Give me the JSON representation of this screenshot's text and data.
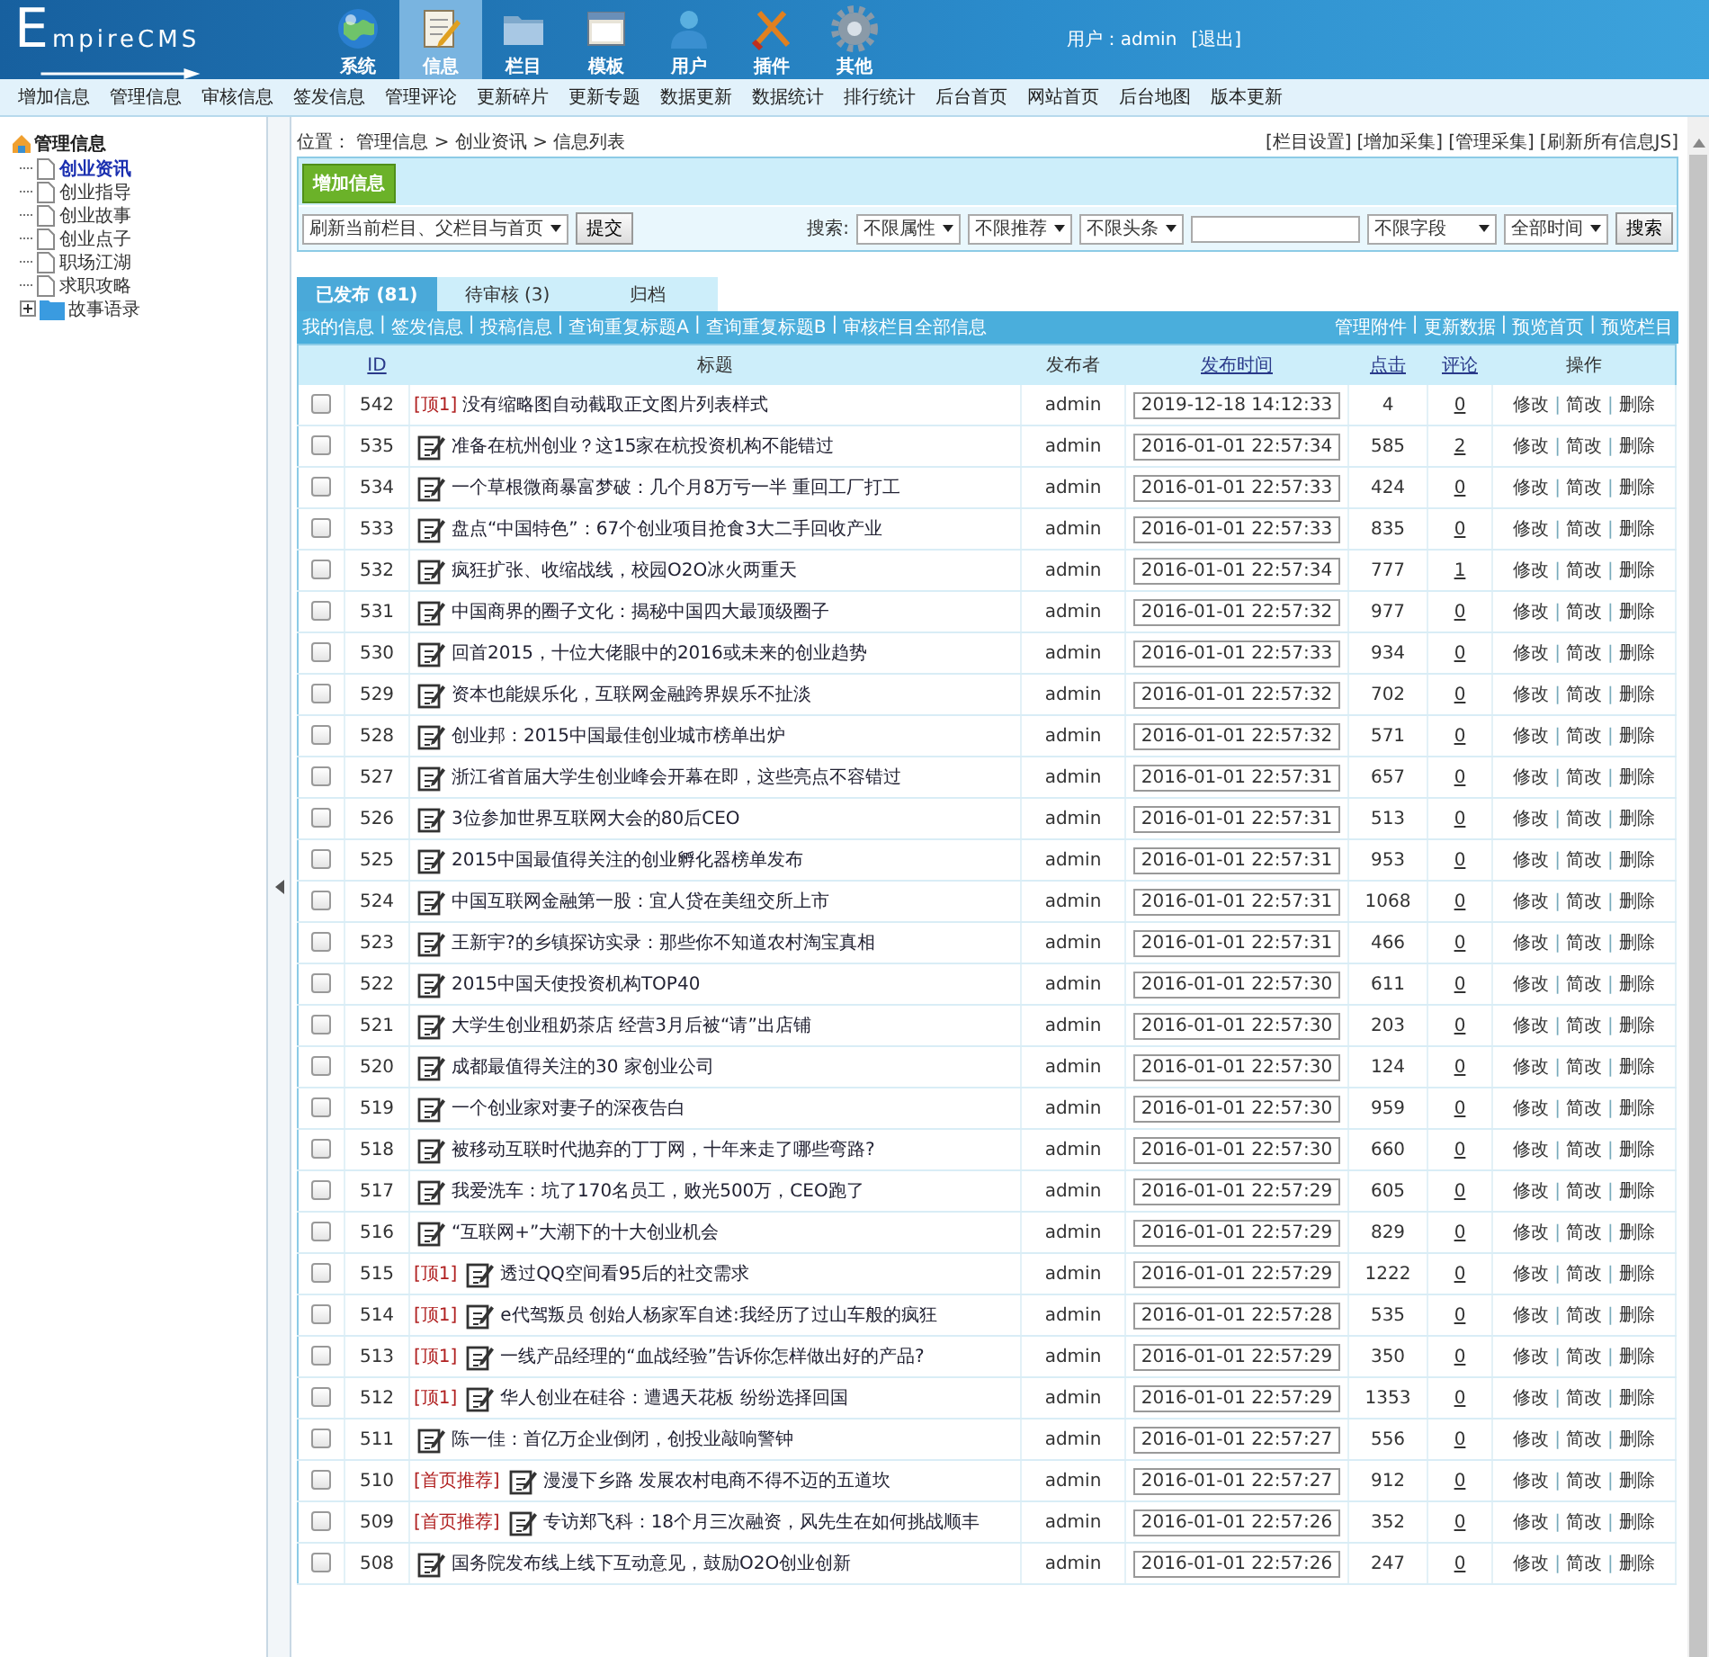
{
  "header": {
    "logo": "EmpireCMS",
    "nav": [
      {
        "label": "系统",
        "selected": false
      },
      {
        "label": "信息",
        "selected": true
      },
      {
        "label": "栏目",
        "selected": false
      },
      {
        "label": "模板",
        "selected": false
      },
      {
        "label": "用户",
        "selected": false
      },
      {
        "label": "插件",
        "selected": false
      },
      {
        "label": "其他",
        "selected": false
      }
    ],
    "user": "用户：admin",
    "logout": "[退出]"
  },
  "menu": [
    "增加信息",
    "管理信息",
    "审核信息",
    "签发信息",
    "管理评论",
    "更新碎片",
    "更新专题",
    "数据更新",
    "数据统计",
    "排行统计",
    "后台首页",
    "网站首页",
    "后台地图",
    "版本更新"
  ],
  "sidebar": {
    "root": "管理信息",
    "items": [
      {
        "label": "创业资讯",
        "selected": true,
        "kind": "page"
      },
      {
        "label": "创业指导",
        "selected": false,
        "kind": "page"
      },
      {
        "label": "创业故事",
        "selected": false,
        "kind": "page"
      },
      {
        "label": "创业点子",
        "selected": false,
        "kind": "page"
      },
      {
        "label": "职场江湖",
        "selected": false,
        "kind": "page"
      },
      {
        "label": "求职攻略",
        "selected": false,
        "kind": "page"
      },
      {
        "label": "故事语录",
        "selected": false,
        "kind": "folder",
        "expanded": false
      }
    ]
  },
  "breadcrumb": {
    "label": "位置：",
    "path": "管理信息 > 创业资讯 > 信息列表"
  },
  "top_links": [
    "[栏目设置]",
    "[增加采集]",
    "[管理采集]",
    "[刷新所有信息JS]"
  ],
  "toolbar": {
    "add_button": "增加信息",
    "refresh_select": "刷新当前栏目、父栏目与首页",
    "submit_button": "提交",
    "search_label": "搜索:",
    "filters": [
      "不限属性",
      "不限推荐",
      "不限头条"
    ],
    "field_select": "不限字段",
    "time_select": "全部时间",
    "search_button": "搜索"
  },
  "tabs": [
    {
      "label": "已发布 (81)",
      "selected": true
    },
    {
      "label": "待审核 (3)",
      "selected": false
    },
    {
      "label": "归档",
      "selected": false
    }
  ],
  "separator": "|",
  "links_left": [
    "我的信息",
    "签发信息",
    "投稿信息",
    "查询重复标题A",
    "查询重复标题B",
    "审核栏目全部信息"
  ],
  "links_right": [
    "管理附件",
    "更新数据",
    "预览首页",
    "预览栏目"
  ],
  "table": {
    "columns": [
      {
        "label": "ID",
        "sortable": true
      },
      {
        "label": "标题",
        "sortable": false
      },
      {
        "label": "发布者",
        "sortable": false
      },
      {
        "label": "发布时间",
        "sortable": true
      },
      {
        "label": "点击",
        "sortable": true
      },
      {
        "label": "评论",
        "sortable": true
      },
      {
        "label": "操作",
        "sortable": false
      }
    ],
    "rows": [
      {
        "id": "542",
        "tag": "[顶1]",
        "icon": false,
        "title": "没有缩略图自动截取正文图片列表样式",
        "author": "admin",
        "time": "2019-12-18 14:12:33",
        "clicks": "4",
        "comments": "0",
        "checked": false,
        "actions": [
          "修改",
          "简改",
          "删除"
        ]
      },
      {
        "id": "535",
        "icon": true,
        "title": "准备在杭州创业？这15家在杭投资机构不能错过",
        "author": "admin",
        "time": "2016-01-01 22:57:34",
        "clicks": "585",
        "comments": "2",
        "checked": false,
        "actions": [
          "修改",
          "简改",
          "删除"
        ]
      },
      {
        "id": "534",
        "icon": true,
        "title": "一个草根微商暴富梦破：几个月8万亏一半 重回工厂打工",
        "author": "admin",
        "time": "2016-01-01 22:57:33",
        "clicks": "424",
        "comments": "0",
        "checked": false,
        "actions": [
          "修改",
          "简改",
          "删除"
        ]
      },
      {
        "id": "533",
        "icon": true,
        "title": "盘点“中国特色”：67个创业项目抢食3大二手回收产业",
        "author": "admin",
        "time": "2016-01-01 22:57:33",
        "clicks": "835",
        "comments": "0",
        "checked": false,
        "actions": [
          "修改",
          "简改",
          "删除"
        ]
      },
      {
        "id": "532",
        "icon": true,
        "title": "疯狂扩张、收缩战线，校园O2O冰火两重天",
        "author": "admin",
        "time": "2016-01-01 22:57:34",
        "clicks": "777",
        "comments": "1",
        "checked": false,
        "actions": [
          "修改",
          "简改",
          "删除"
        ]
      },
      {
        "id": "531",
        "icon": true,
        "title": "中国商界的圈子文化：揭秘中国四大最顶级圈子",
        "author": "admin",
        "time": "2016-01-01 22:57:32",
        "clicks": "977",
        "comments": "0",
        "checked": false,
        "actions": [
          "修改",
          "简改",
          "删除"
        ]
      },
      {
        "id": "530",
        "icon": true,
        "title": "回首2015，十位大佬眼中的2016或未来的创业趋势",
        "author": "admin",
        "time": "2016-01-01 22:57:33",
        "clicks": "934",
        "comments": "0",
        "checked": false,
        "actions": [
          "修改",
          "简改",
          "删除"
        ]
      },
      {
        "id": "529",
        "icon": true,
        "title": "资本也能娱乐化，互联网金融跨界娱乐不扯淡",
        "author": "admin",
        "time": "2016-01-01 22:57:32",
        "clicks": "702",
        "comments": "0",
        "checked": false,
        "actions": [
          "修改",
          "简改",
          "删除"
        ]
      },
      {
        "id": "528",
        "icon": true,
        "title": "创业邦：2015中国最佳创业城市榜单出炉",
        "author": "admin",
        "time": "2016-01-01 22:57:32",
        "clicks": "571",
        "comments": "0",
        "checked": false,
        "actions": [
          "修改",
          "简改",
          "删除"
        ]
      },
      {
        "id": "527",
        "icon": true,
        "title": "浙江省首届大学生创业峰会开幕在即，这些亮点不容错过",
        "author": "admin",
        "time": "2016-01-01 22:57:31",
        "clicks": "657",
        "comments": "0",
        "checked": false,
        "actions": [
          "修改",
          "简改",
          "删除"
        ]
      },
      {
        "id": "526",
        "icon": true,
        "title": "3位参加世界互联网大会的80后CEO",
        "author": "admin",
        "time": "2016-01-01 22:57:31",
        "clicks": "513",
        "comments": "0",
        "checked": false,
        "actions": [
          "修改",
          "简改",
          "删除"
        ]
      },
      {
        "id": "525",
        "icon": true,
        "title": "2015中国最值得关注的创业孵化器榜单发布",
        "author": "admin",
        "time": "2016-01-01 22:57:31",
        "clicks": "953",
        "comments": "0",
        "checked": false,
        "actions": [
          "修改",
          "简改",
          "删除"
        ]
      },
      {
        "id": "524",
        "icon": true,
        "title": "中国互联网金融第一股：宜人贷在美纽交所上市",
        "author": "admin",
        "time": "2016-01-01 22:57:31",
        "clicks": "1068",
        "comments": "0",
        "checked": false,
        "actions": [
          "修改",
          "简改",
          "删除"
        ]
      },
      {
        "id": "523",
        "icon": true,
        "title": "王新宇?的乡镇探访实录：那些你不知道农村淘宝真相",
        "author": "admin",
        "time": "2016-01-01 22:57:31",
        "clicks": "466",
        "comments": "0",
        "checked": false,
        "actions": [
          "修改",
          "简改",
          "删除"
        ]
      },
      {
        "id": "522",
        "icon": true,
        "title": "2015中国天使投资机构TOP40",
        "author": "admin",
        "time": "2016-01-01 22:57:30",
        "clicks": "611",
        "comments": "0",
        "checked": false,
        "actions": [
          "修改",
          "简改",
          "删除"
        ]
      },
      {
        "id": "521",
        "icon": true,
        "title": "大学生创业租奶茶店 经营3月后被“请”出店铺",
        "author": "admin",
        "time": "2016-01-01 22:57:30",
        "clicks": "203",
        "comments": "0",
        "checked": false,
        "actions": [
          "修改",
          "简改",
          "删除"
        ]
      },
      {
        "id": "520",
        "icon": true,
        "title": "成都最值得关注的30 家创业公司",
        "author": "admin",
        "time": "2016-01-01 22:57:30",
        "clicks": "124",
        "comments": "0",
        "checked": false,
        "actions": [
          "修改",
          "简改",
          "删除"
        ]
      },
      {
        "id": "519",
        "icon": true,
        "title": "一个创业家对妻子的深夜告白",
        "author": "admin",
        "time": "2016-01-01 22:57:30",
        "clicks": "959",
        "comments": "0",
        "checked": false,
        "actions": [
          "修改",
          "简改",
          "删除"
        ]
      },
      {
        "id": "518",
        "icon": true,
        "title": "被移动互联时代抛弃的丁丁网，十年来走了哪些弯路?",
        "author": "admin",
        "time": "2016-01-01 22:57:30",
        "clicks": "660",
        "comments": "0",
        "checked": false,
        "actions": [
          "修改",
          "简改",
          "删除"
        ]
      },
      {
        "id": "517",
        "icon": true,
        "title": "我爱洗车：坑了170名员工，败光500万，CEO跑了",
        "author": "admin",
        "time": "2016-01-01 22:57:29",
        "clicks": "605",
        "comments": "0",
        "checked": false,
        "actions": [
          "修改",
          "简改",
          "删除"
        ]
      },
      {
        "id": "516",
        "icon": true,
        "title": "“互联网+”大潮下的十大创业机会",
        "author": "admin",
        "time": "2016-01-01 22:57:29",
        "clicks": "829",
        "comments": "0",
        "checked": false,
        "actions": [
          "修改",
          "简改",
          "删除"
        ]
      },
      {
        "id": "515",
        "tag": "[顶1]",
        "icon": true,
        "title": "透过QQ空间看95后的社交需求",
        "author": "admin",
        "time": "2016-01-01 22:57:29",
        "clicks": "1222",
        "comments": "0",
        "checked": false,
        "actions": [
          "修改",
          "简改",
          "删除"
        ]
      },
      {
        "id": "514",
        "tag": "[顶1]",
        "icon": true,
        "title": "e代驾叛员 创始人杨家军自述:我经历了过山车般的疯狂",
        "author": "admin",
        "time": "2016-01-01 22:57:28",
        "clicks": "535",
        "comments": "0",
        "checked": false,
        "actions": [
          "修改",
          "简改",
          "删除"
        ]
      },
      {
        "id": "513",
        "tag": "[顶1]",
        "icon": true,
        "title": "一线产品经理的“血战经验”告诉你怎样做出好的产品?",
        "author": "admin",
        "time": "2016-01-01 22:57:29",
        "clicks": "350",
        "comments": "0",
        "checked": false,
        "actions": [
          "修改",
          "简改",
          "删除"
        ]
      },
      {
        "id": "512",
        "tag": "[顶1]",
        "icon": true,
        "title": "华人创业在硅谷：遭遇天花板 纷纷选择回国",
        "author": "admin",
        "time": "2016-01-01 22:57:29",
        "clicks": "1353",
        "comments": "0",
        "checked": false,
        "actions": [
          "修改",
          "简改",
          "删除"
        ]
      },
      {
        "id": "511",
        "icon": true,
        "title": "陈一佳：首亿万企业倒闭，创投业敲响警钟",
        "author": "admin",
        "time": "2016-01-01 22:57:27",
        "clicks": "556",
        "comments": "0",
        "checked": false,
        "actions": [
          "修改",
          "简改",
          "删除"
        ]
      },
      {
        "id": "510",
        "tag": "[首页推荐]",
        "icon": true,
        "title": "漫漫下乡路 发展农村电商不得不迈的五道坎",
        "author": "admin",
        "time": "2016-01-01 22:57:27",
        "clicks": "912",
        "comments": "0",
        "checked": false,
        "actions": [
          "修改",
          "简改",
          "删除"
        ]
      },
      {
        "id": "509",
        "tag": "[首页推荐]",
        "icon": true,
        "title": "专访郑飞科：18个月三次融资，风先生在如何挑战顺丰",
        "author": "admin",
        "time": "2016-01-01 22:57:26",
        "clicks": "352",
        "comments": "0",
        "checked": false,
        "actions": [
          "修改",
          "简改",
          "删除"
        ]
      },
      {
        "id": "508",
        "icon": true,
        "title": "国务院发布线上线下互动意见，鼓励O2O创业创新",
        "author": "admin",
        "time": "2016-01-01 22:57:26",
        "clicks": "247",
        "comments": "0",
        "checked": false,
        "actions": [
          "修改",
          "简改",
          "删除"
        ]
      }
    ]
  }
}
